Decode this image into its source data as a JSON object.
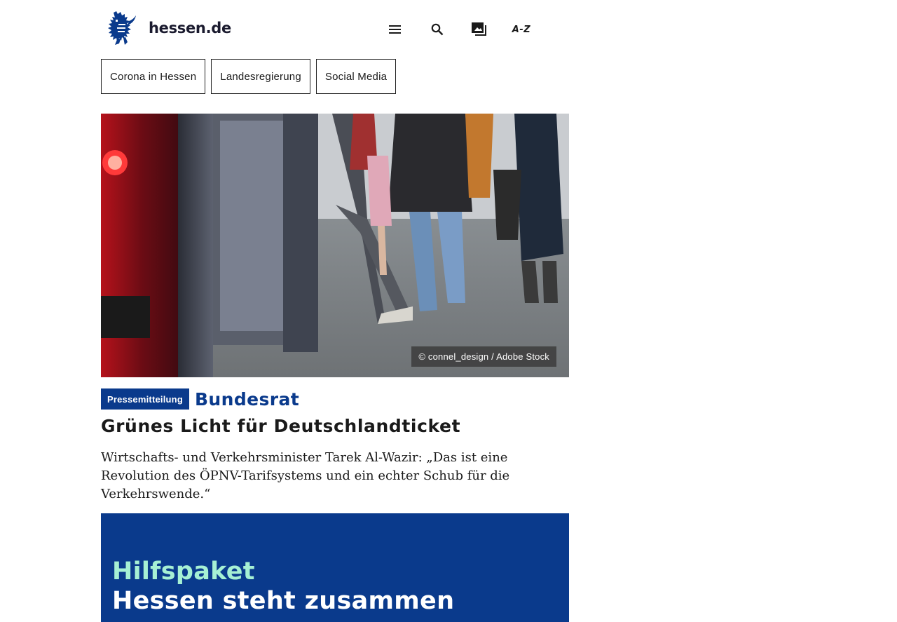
{
  "header": {
    "logo_text": "hessen.de",
    "icons": {
      "menu": "menu-icon",
      "search": "search-icon",
      "mediathek": "media-gallery-icon",
      "az": "A-Z"
    }
  },
  "quicklinks": [
    {
      "label": "Corona in Hessen"
    },
    {
      "label": "Landesregierung"
    },
    {
      "label": "Social Media"
    }
  ],
  "article": {
    "image_credit": "© connel_design / Adobe Stock",
    "badge": "Pressemitteilung",
    "kicker": "Bundesrat",
    "headline": "Grünes Licht für Deutschlandticket",
    "teaser": "Wirtschafts- und Verkehrsminister Tarek Al-Wazir: „Das ist eine Revolution des ÖPNV-Tarifsystems und ein echter Schub für die Verkehrswende.“"
  },
  "promo": {
    "line1": "Hilfspaket",
    "line2": "Hessen steht zusammen"
  },
  "colors": {
    "brand_blue": "#0a3a8c",
    "mint": "#a6f0d4",
    "text": "#1a1a1a"
  }
}
